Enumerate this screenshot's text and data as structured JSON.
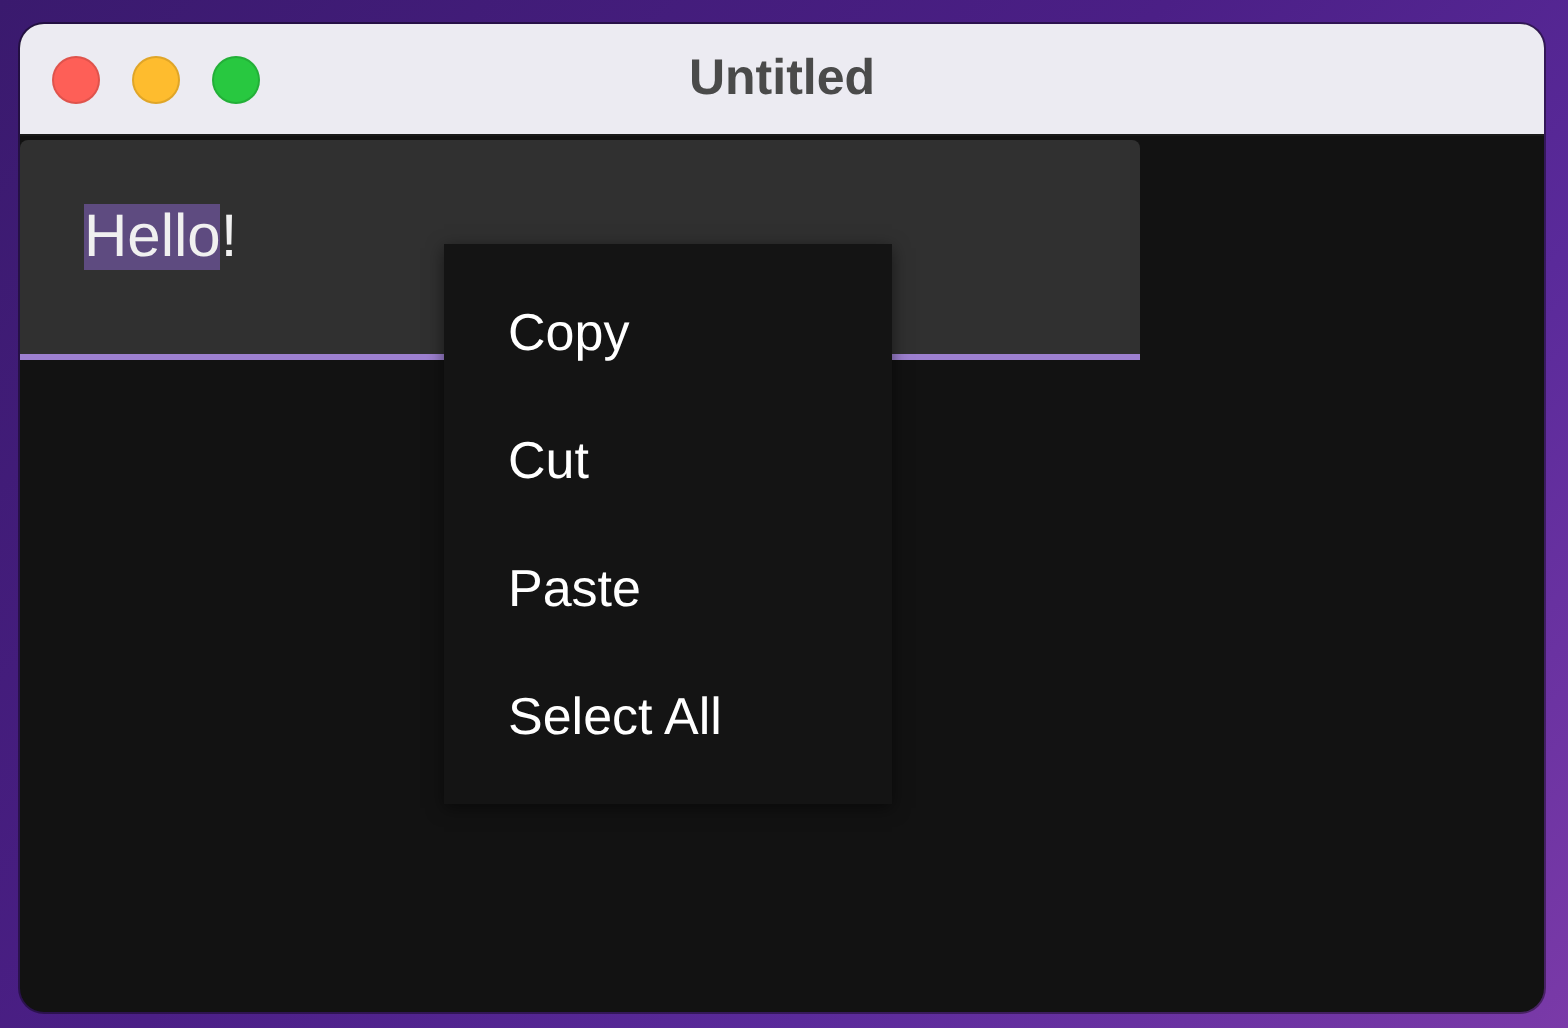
{
  "window": {
    "title": "Untitled"
  },
  "text_field": {
    "focused": true,
    "segments": [
      {
        "text": "Hello",
        "selected": true
      },
      {
        "text": "!",
        "selected": false
      }
    ]
  },
  "context_menu": {
    "items": [
      {
        "label": "Copy"
      },
      {
        "label": "Cut"
      },
      {
        "label": "Paste"
      },
      {
        "label": "Select All"
      }
    ]
  }
}
